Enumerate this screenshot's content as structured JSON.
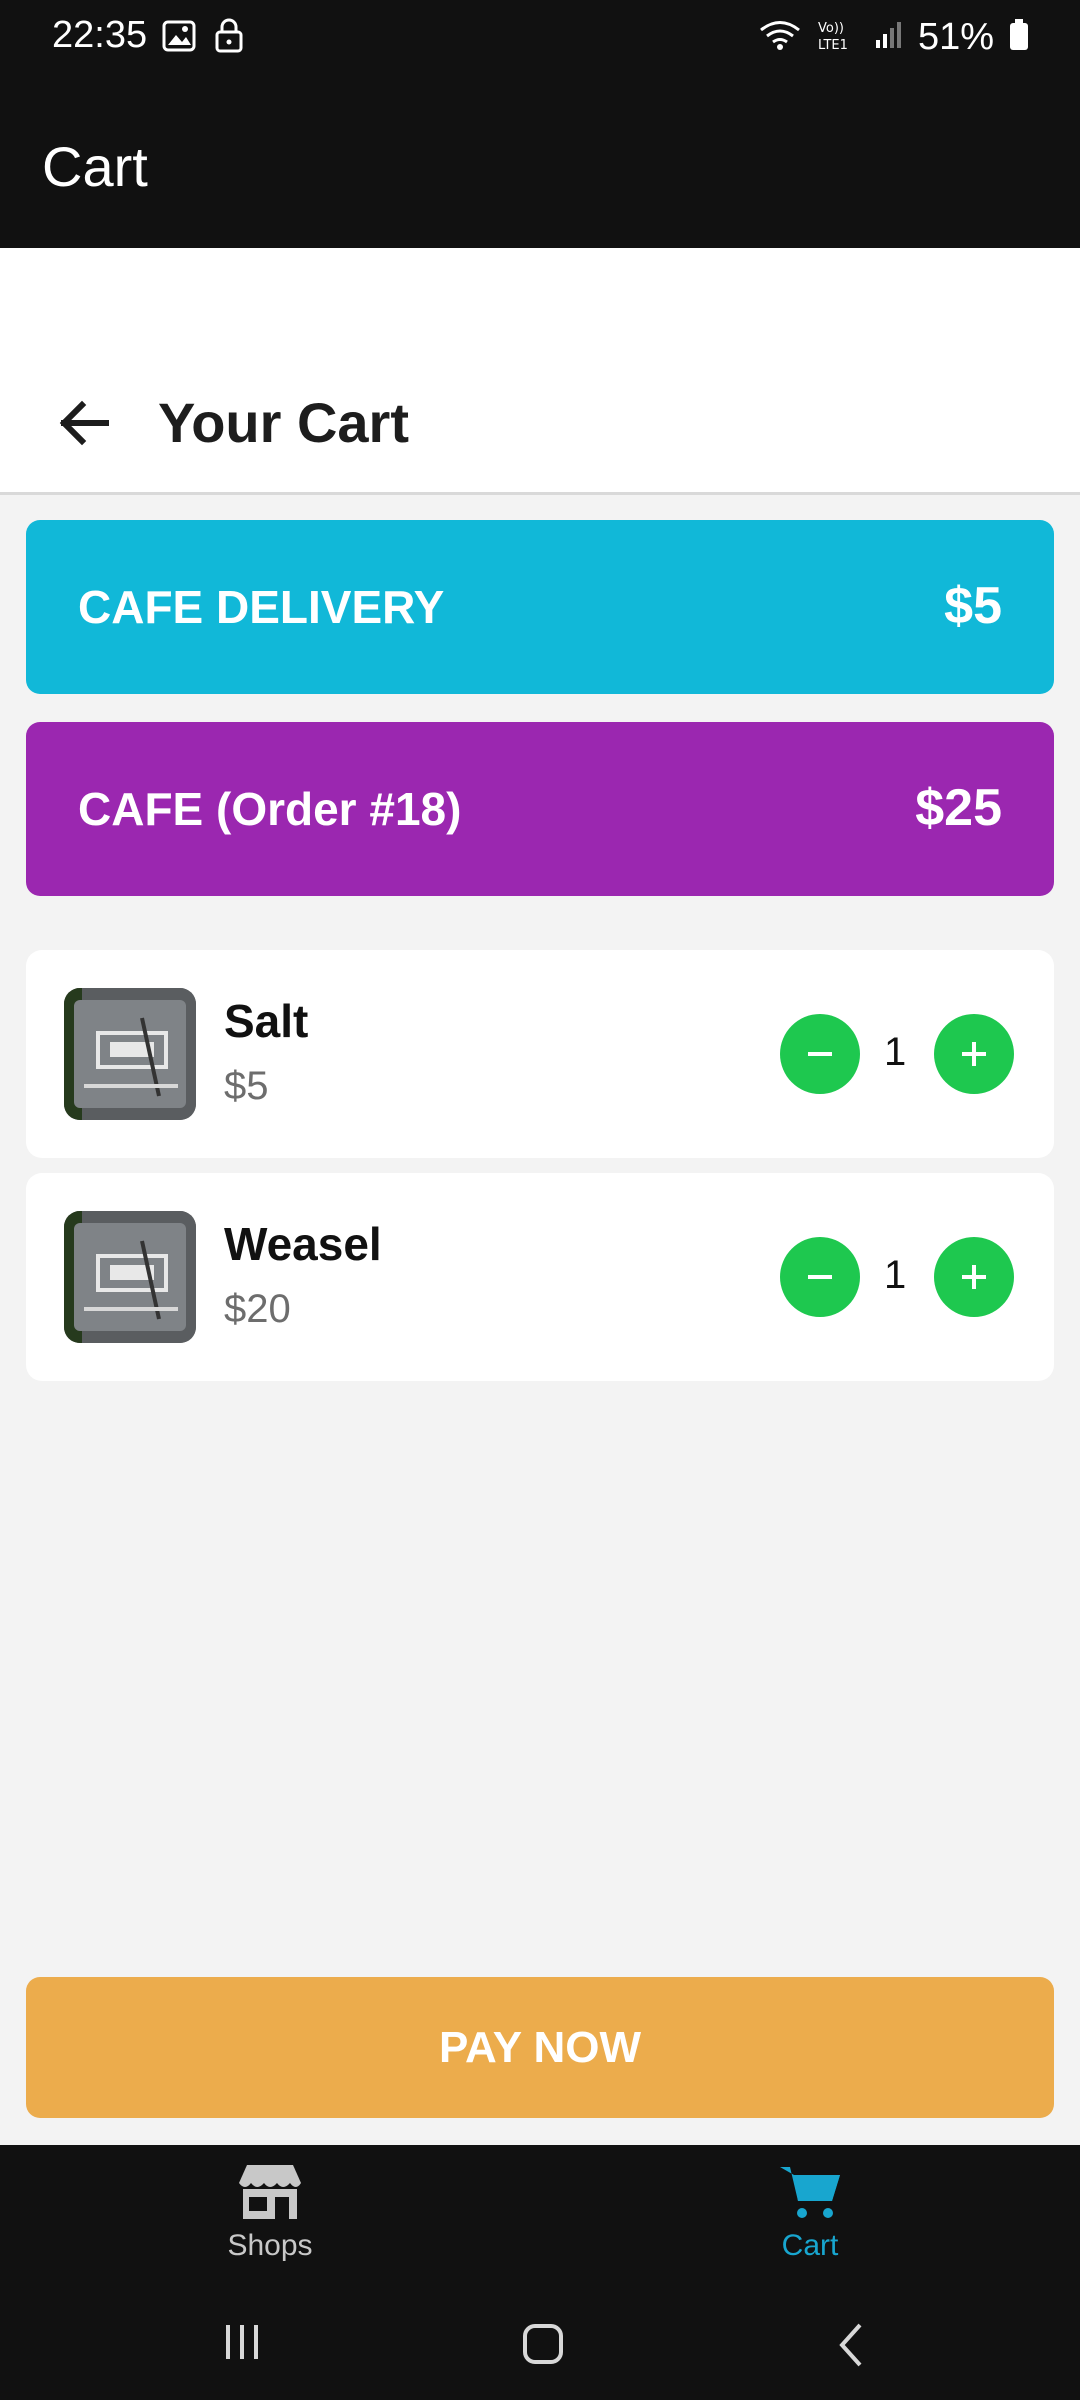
{
  "status_bar": {
    "time": "22:35",
    "battery": "51%",
    "left_icons": [
      "image-icon",
      "lock-icon"
    ],
    "right_icons": [
      "wifi-icon",
      "volte-lte-icon",
      "signal-icon",
      "battery-icon"
    ]
  },
  "app_bar": {
    "title": "Cart"
  },
  "header": {
    "title": "Your Cart"
  },
  "banners": {
    "delivery": {
      "label": "CAFE DELIVERY",
      "amount": "$5",
      "color": "#11b8d8"
    },
    "order": {
      "label": "CAFE (Order #18)",
      "amount": "$25",
      "color": "#9b27b0"
    }
  },
  "items": [
    {
      "name": "Salt",
      "price": "$5",
      "quantity": "1"
    },
    {
      "name": "Weasel",
      "price": "$20",
      "quantity": "1"
    }
  ],
  "pay_button": {
    "label": "PAY NOW",
    "color": "#ecac4c"
  },
  "bottom_nav": {
    "items": [
      {
        "label": "Shops",
        "icon": "store-icon",
        "active": false
      },
      {
        "label": "Cart",
        "icon": "cart-icon",
        "active": true
      }
    ]
  },
  "colors": {
    "status_bar": "#111111",
    "accent_green": "#1ec84f",
    "active_nav": "#18a6cf",
    "background": "#f3f3f3"
  }
}
